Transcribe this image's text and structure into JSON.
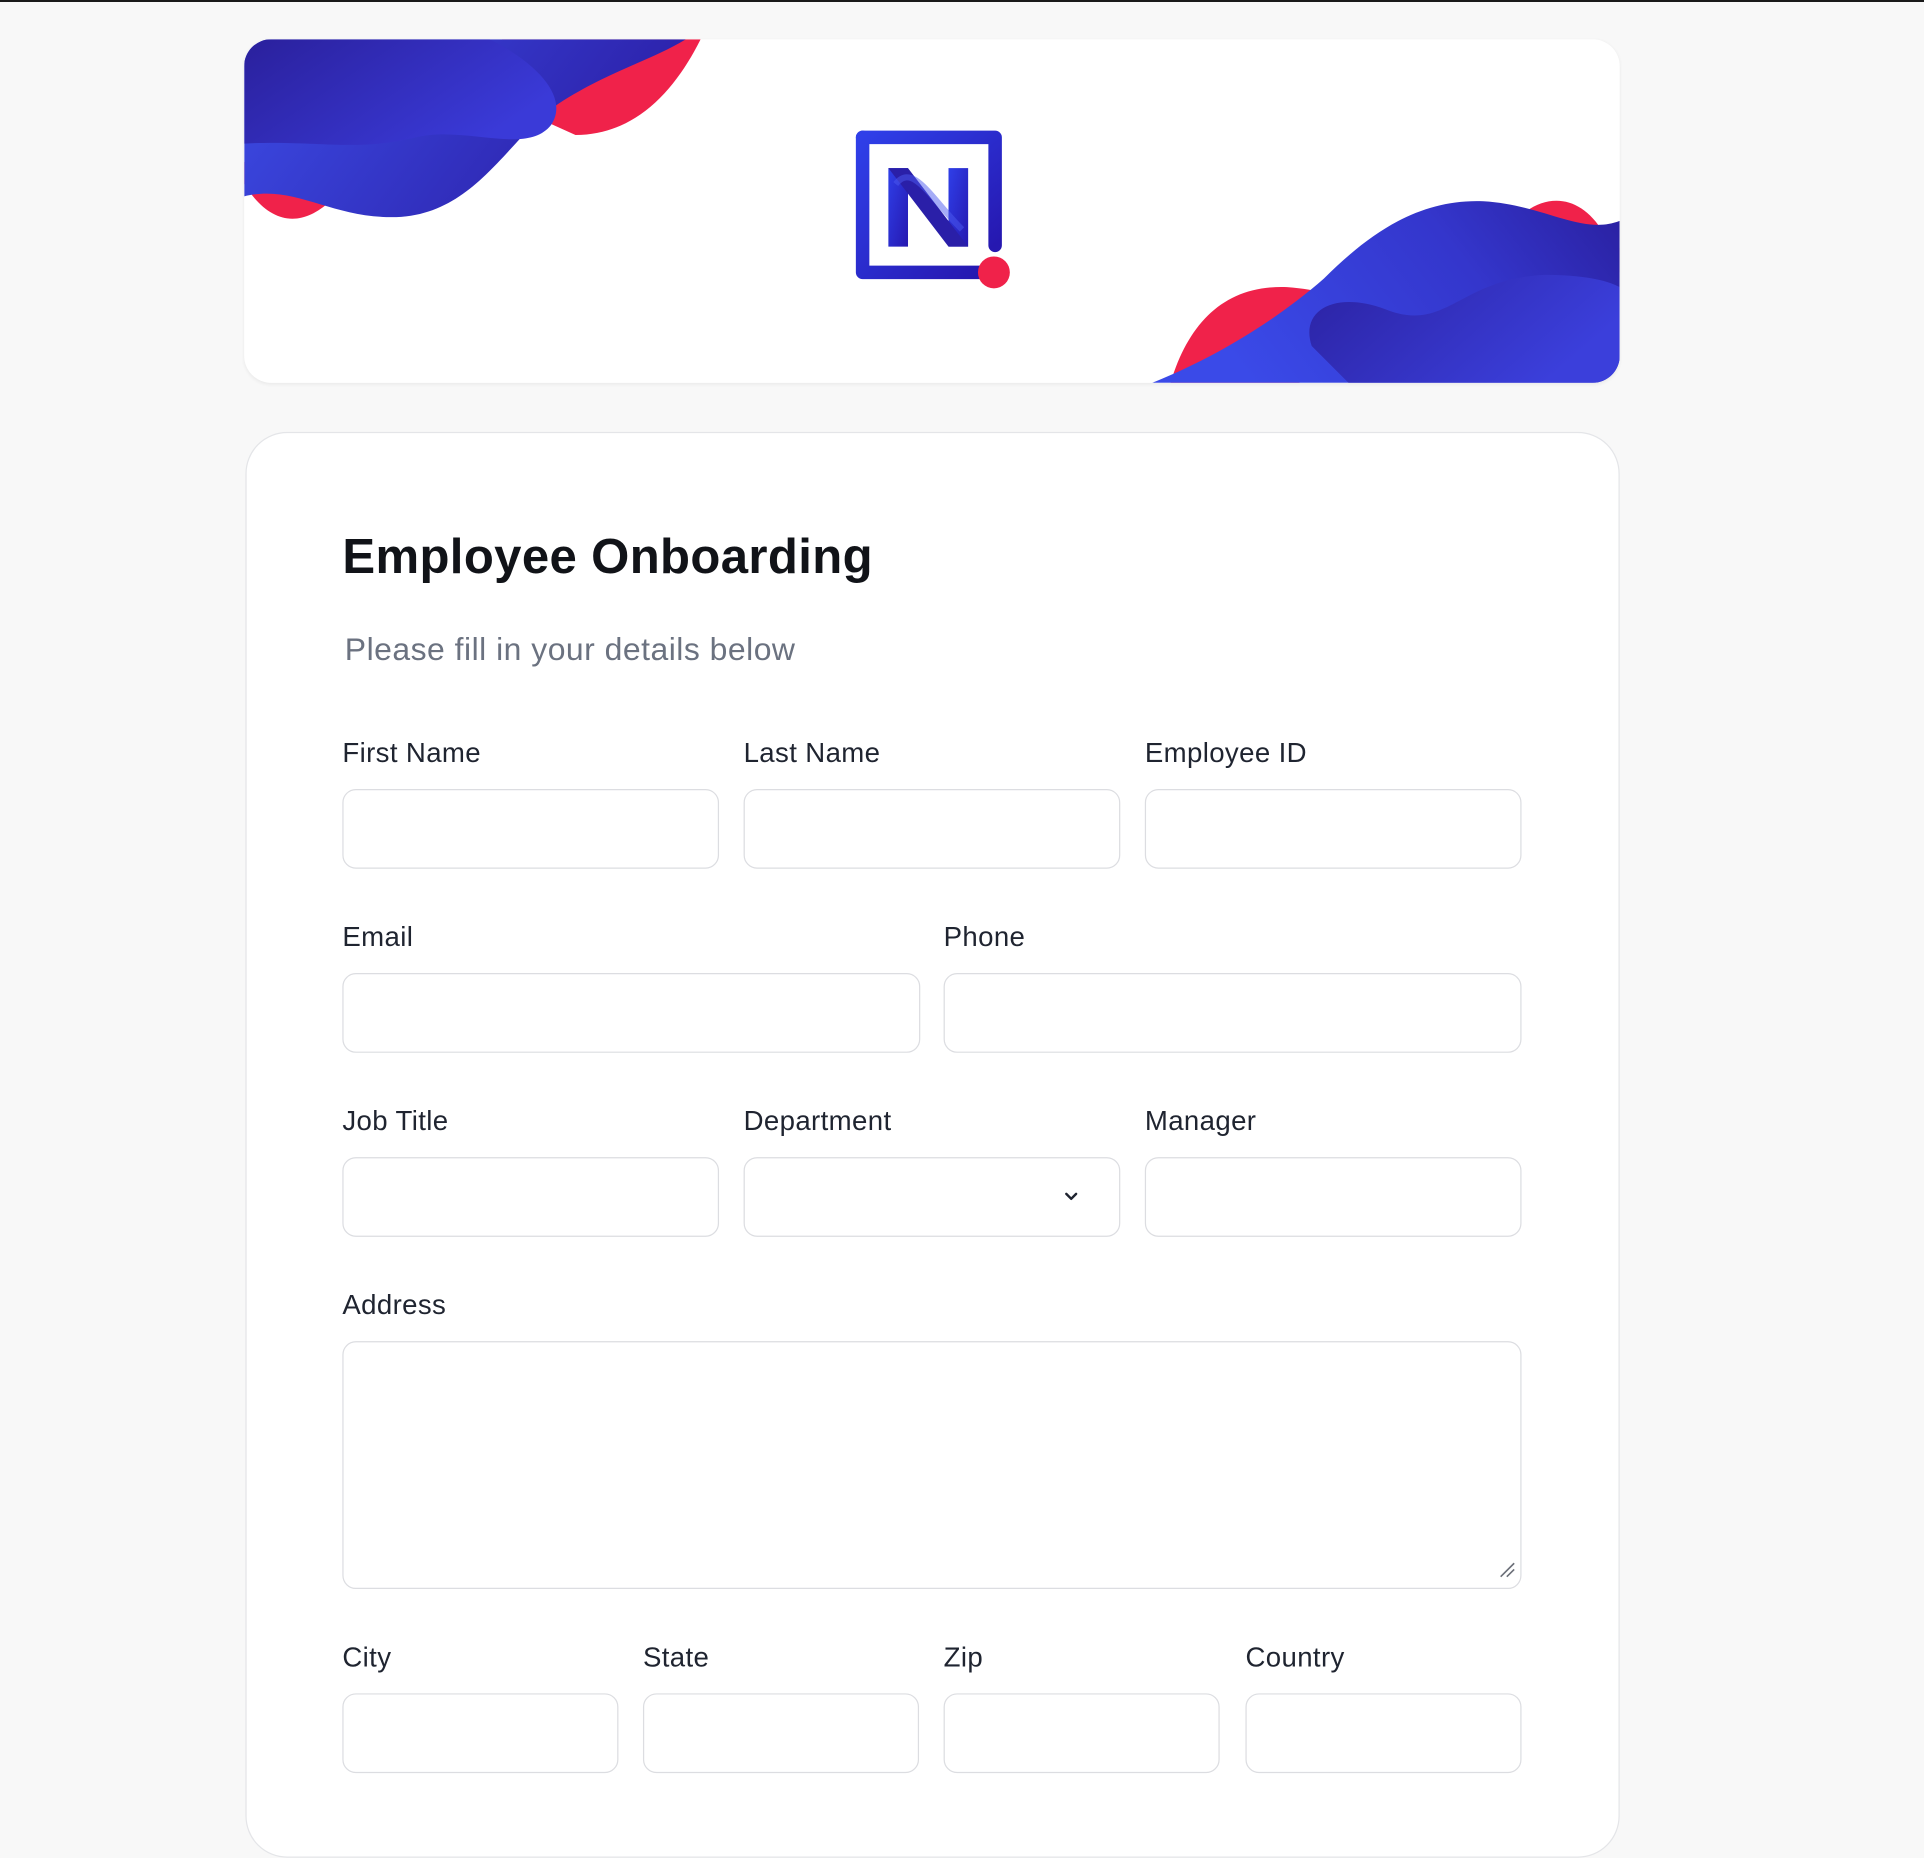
{
  "form": {
    "title": "Employee Onboarding",
    "subtitle": "Please fill in your details below",
    "fields": {
      "first_name": {
        "label": "First Name",
        "value": ""
      },
      "last_name": {
        "label": "Last Name",
        "value": ""
      },
      "employee_id": {
        "label": "Employee ID",
        "value": ""
      },
      "email": {
        "label": "Email",
        "value": ""
      },
      "phone": {
        "label": "Phone",
        "value": ""
      },
      "job_title": {
        "label": "Job Title",
        "value": ""
      },
      "department": {
        "label": "Department",
        "value": ""
      },
      "manager": {
        "label": "Manager",
        "value": ""
      },
      "address": {
        "label": "Address",
        "value": ""
      },
      "city": {
        "label": "City",
        "value": ""
      },
      "state": {
        "label": "State",
        "value": ""
      },
      "zip": {
        "label": "Zip",
        "value": ""
      },
      "country": {
        "label": "Country",
        "value": ""
      }
    }
  },
  "icons": {
    "logo": "brand-logo-icon",
    "dropdown": "chevron-down-icon",
    "resize": "resize-grip-icon"
  },
  "colors": {
    "brand_blue": "#2f2fd4",
    "brand_indigo": "#2b22a8",
    "brand_red": "#f0224a",
    "border": "#dcdde1",
    "page_bg": "#f8f8f8"
  }
}
